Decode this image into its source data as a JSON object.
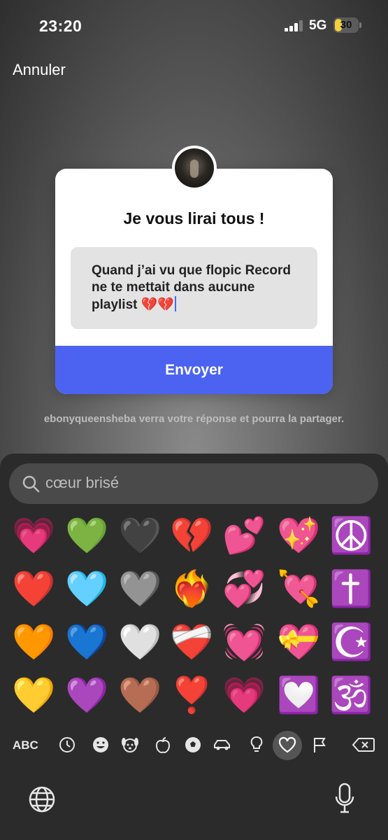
{
  "status_bar": {
    "time": "23:20",
    "network": "5G",
    "battery_level": "30"
  },
  "header": {
    "cancel_label": "Annuler"
  },
  "card": {
    "title": "Je vous lirai tous !",
    "answer_text": "Quand j’ai vu que flopic Record ne te mettait dans aucune playlist 💔💔",
    "send_label": "Envoyer"
  },
  "hint": "ebonyqueensheba verra votre réponse et pourra la partager.",
  "keyboard": {
    "search_value": "cœur brisé",
    "emoji_rows": [
      [
        "💗",
        "💚",
        "🖤",
        "💔",
        "💕",
        "💖",
        "☮️"
      ],
      [
        "❤️",
        "🩵",
        "🩶",
        "❤️‍🔥",
        "💞",
        "💘",
        "✝️"
      ],
      [
        "🧡",
        "💙",
        "🤍",
        "❤️‍🩹",
        "💓",
        "💝",
        "☪️"
      ],
      [
        "💛",
        "💜",
        "🤎",
        "❣️",
        "💗",
        "💟",
        "🕉️"
      ]
    ],
    "abc_label": "ABC",
    "categories": [
      "clock-icon",
      "smiley-icon",
      "dog-icon",
      "apple-icon",
      "ball-icon",
      "car-icon",
      "bulb-icon",
      "heart-icon",
      "flag-icon",
      "delete-icon"
    ]
  }
}
